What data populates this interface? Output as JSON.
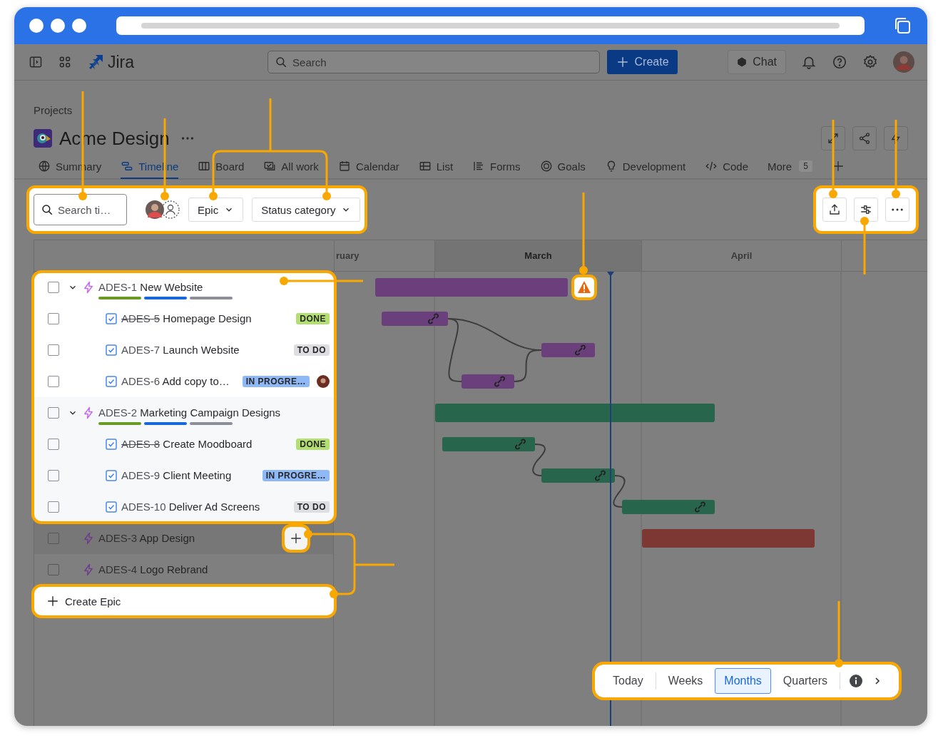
{
  "top_nav": {
    "app_name": "Jira",
    "search": {
      "placeholder": "Search"
    },
    "create_button": "Create",
    "chat_button": "Chat"
  },
  "project": {
    "breadcrumb": "Projects",
    "name": "Acme Design"
  },
  "tabs": [
    {
      "label": "Summary",
      "selected": false
    },
    {
      "label": "Timeline",
      "selected": true
    },
    {
      "label": "Board",
      "selected": false
    },
    {
      "label": "All work",
      "selected": false
    },
    {
      "label": "Calendar",
      "selected": false
    },
    {
      "label": "List",
      "selected": false
    },
    {
      "label": "Forms",
      "selected": false
    },
    {
      "label": "Goals",
      "selected": false
    },
    {
      "label": "Development",
      "selected": false
    },
    {
      "label": "Code",
      "selected": false
    }
  ],
  "more_tab": {
    "label": "More",
    "count": "5"
  },
  "toolbar": {
    "highlighted": true,
    "search": {
      "placeholder": "Search ti…"
    },
    "filters": [
      "Epic",
      "Status category"
    ],
    "actions_highlighted": true
  },
  "timeline": {
    "months": [
      "ruary",
      "March",
      "April"
    ],
    "epics": [
      {
        "key": "ADES-1",
        "title": "New Website",
        "checked": false,
        "expanded": true,
        "highlighted": true,
        "warning": true,
        "add_button": false,
        "color": "#6a3f7c",
        "children": [
          {
            "key": "ADES-5",
            "title": "Homepage Design",
            "status": "DONE",
            "color": "#b3df72",
            "resolved": true,
            "checked": false,
            "avatar": false
          },
          {
            "key": "ADES-7",
            "title": "Launch Website",
            "status": "TO DO",
            "color": "#dddee1",
            "resolved": false,
            "checked": false,
            "avatar": false
          },
          {
            "key": "ADES-6",
            "title": "Add copy to…",
            "status": "IN PROGRE…",
            "color": "#8fb8f6",
            "resolved": false,
            "checked": false,
            "avatar": true
          }
        ]
      },
      {
        "key": "ADES-2",
        "title": "Marketing Campaign Designs",
        "checked": false,
        "expanded": true,
        "highlighted": true,
        "warning": false,
        "add_button": false,
        "color": "#27664c",
        "children": [
          {
            "key": "ADES-8",
            "title": "Create Moodboard",
            "status": "DONE",
            "color": "#b3df72",
            "resolved": true,
            "checked": false,
            "avatar": false
          },
          {
            "key": "ADES-9",
            "title": "Client Meeting",
            "status": "IN PROGRE…",
            "color": "#8fb8f6",
            "resolved": false,
            "checked": false,
            "avatar": false
          },
          {
            "key": "ADES-10",
            "title": "Deliver Ad Screens",
            "status": "TO DO",
            "color": "#dddee1",
            "resolved": false,
            "checked": false,
            "avatar": false
          }
        ]
      },
      {
        "key": "ADES-3",
        "title": "App Design",
        "checked": false,
        "expanded": false,
        "highlighted": false,
        "warning": false,
        "add_button": true,
        "color": "#7e3833"
      },
      {
        "key": "ADES-4",
        "title": "Logo Rebrand",
        "checked": false,
        "expanded": false,
        "highlighted": false,
        "warning": false,
        "add_button": false
      }
    ],
    "create_epic": {
      "label": "Create Epic",
      "highlighted": true
    }
  },
  "zoom_bar": {
    "highlighted": true,
    "today": "Today",
    "scales": [
      {
        "label": "Weeks",
        "selected": false
      },
      {
        "label": "Months",
        "selected": true
      },
      {
        "label": "Quarters",
        "selected": false
      }
    ]
  }
}
